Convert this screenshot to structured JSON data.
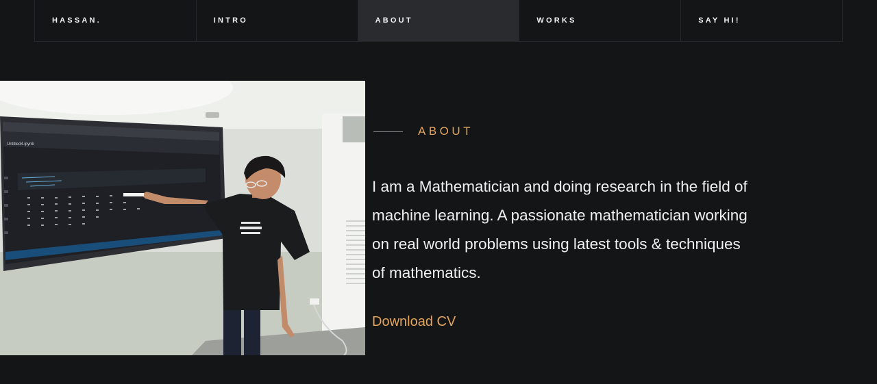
{
  "nav": {
    "items": [
      {
        "label": "HASSAN."
      },
      {
        "label": "INTRO"
      },
      {
        "label": "ABOUT"
      },
      {
        "label": "WORKS"
      },
      {
        "label": "SAY HI!"
      }
    ],
    "active_index": 2
  },
  "about": {
    "title": "ABOUT",
    "text": "I am a Mathematician and doing research in the field of machine learning. A passionate mathematician working on real world problems using latest tools & techniques of mathematics.",
    "cv_label": "Download CV"
  },
  "photo": {
    "screen_tab_label": "Untitled4.ipynb"
  },
  "colors": {
    "background": "#141517",
    "accent": "#e3a45c",
    "nav_active": "#2a2b2e",
    "text": "#f0f0f0"
  }
}
